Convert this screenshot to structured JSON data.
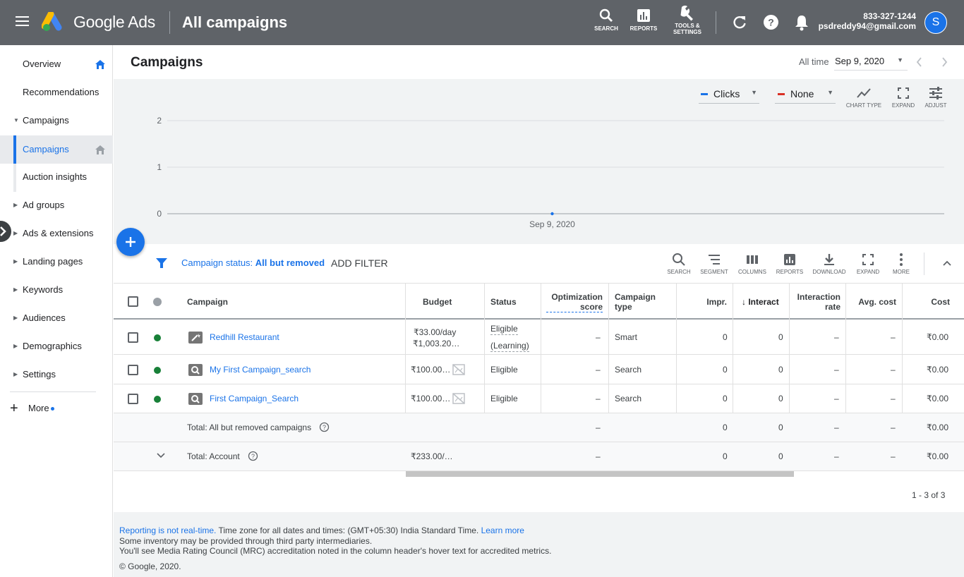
{
  "topbar": {
    "product": "Google Ads",
    "page_title": "All campaigns",
    "search_label": "SEARCH",
    "reports_label": "REPORTS",
    "tools_label_1": "TOOLS &",
    "tools_label_2": "SETTINGS",
    "phone": "833-327-1244",
    "email": "psdreddy94@gmail.com",
    "avatar_letter": "S",
    "bg_color": "#5f6368"
  },
  "sidebar": {
    "items": [
      {
        "label": "Overview"
      },
      {
        "label": "Recommendations"
      },
      {
        "label": "Campaigns"
      },
      {
        "label": "Campaigns"
      },
      {
        "label": "Auction insights"
      },
      {
        "label": "Ad groups"
      },
      {
        "label": "Ads & extensions"
      },
      {
        "label": "Landing pages"
      },
      {
        "label": "Keywords"
      },
      {
        "label": "Audiences"
      },
      {
        "label": "Demographics"
      },
      {
        "label": "Settings"
      }
    ],
    "more_label": "More"
  },
  "header": {
    "title": "Campaigns",
    "range_label": "All time",
    "date": "Sep 9, 2020"
  },
  "chart_controls": {
    "metric1": "Clicks",
    "metric2": "None",
    "chart_type": "CHART TYPE",
    "expand": "EXPAND",
    "adjust": "ADJUST"
  },
  "chart_data": {
    "type": "line",
    "series": [
      {
        "name": "Clicks",
        "values": [
          0
        ]
      }
    ],
    "categories": [
      "Sep 9, 2020"
    ],
    "ylim": [
      0,
      2
    ],
    "yticks": [
      "2",
      "1",
      "0"
    ],
    "xtick": "Sep 9, 2020",
    "grid": true,
    "series_color": "#1a73e8"
  },
  "filterbar": {
    "status_label": "Campaign status:",
    "status_value": "All but removed",
    "add_filter": "ADD FILTER",
    "tools": [
      "SEARCH",
      "SEGMENT",
      "COLUMNS",
      "REPORTS",
      "DOWNLOAD",
      "EXPAND",
      "MORE"
    ]
  },
  "table": {
    "headers": {
      "campaign": "Campaign",
      "budget": "Budget",
      "status": "Status",
      "opt1": "Optimization",
      "opt2": "score",
      "type1": "Campaign",
      "type2": "type",
      "impr": "Impr.",
      "interactions": "Interact",
      "irate1": "Interaction",
      "irate2": "rate",
      "avgcost": "Avg. cost",
      "cost": "Cost"
    },
    "rows": [
      {
        "name": "Redhill Restaurant",
        "budget1": "₹33.00/day",
        "budget2": "₹1,003.20…",
        "status1": "Eligible",
        "status2": "(Learning)",
        "opt": "–",
        "type": "Smart",
        "impr": "0",
        "inter": "0",
        "irate": "–",
        "avg": "–",
        "cost": "₹0.00"
      },
      {
        "name": "My First Campaign_search",
        "budget1": "₹100.00…",
        "status1": "Eligible",
        "opt": "–",
        "type": "Search",
        "impr": "0",
        "inter": "0",
        "irate": "–",
        "avg": "–",
        "cost": "₹0.00"
      },
      {
        "name": "First Campaign_Search",
        "budget1": "₹100.00…",
        "status1": "Eligible",
        "opt": "–",
        "type": "Search",
        "impr": "0",
        "inter": "0",
        "irate": "–",
        "avg": "–",
        "cost": "₹0.00"
      }
    ],
    "total_removed": {
      "label": "Total: All but removed campaigns",
      "opt": "–",
      "impr": "0",
      "inter": "0",
      "irate": "–",
      "avg": "–",
      "cost": "₹0.00"
    },
    "total_account": {
      "label": "Total: Account",
      "budget": "₹233.00/…",
      "opt": "–",
      "impr": "0",
      "inter": "0",
      "irate": "–",
      "avg": "–",
      "cost": "₹0.00"
    },
    "pagination": "1 - 3 of 3"
  },
  "footer": {
    "link1": "Reporting is not real-time.",
    "text1": " Time zone for all dates and times: (GMT+05:30) India Standard Time. ",
    "link2": "Learn more",
    "line2": "Some inventory may be provided through third party intermediaries.",
    "line3": "You'll see Media Rating Council (MRC) accreditation noted in the column header's hover text for accredited metrics.",
    "copyright": "© Google, 2020."
  }
}
